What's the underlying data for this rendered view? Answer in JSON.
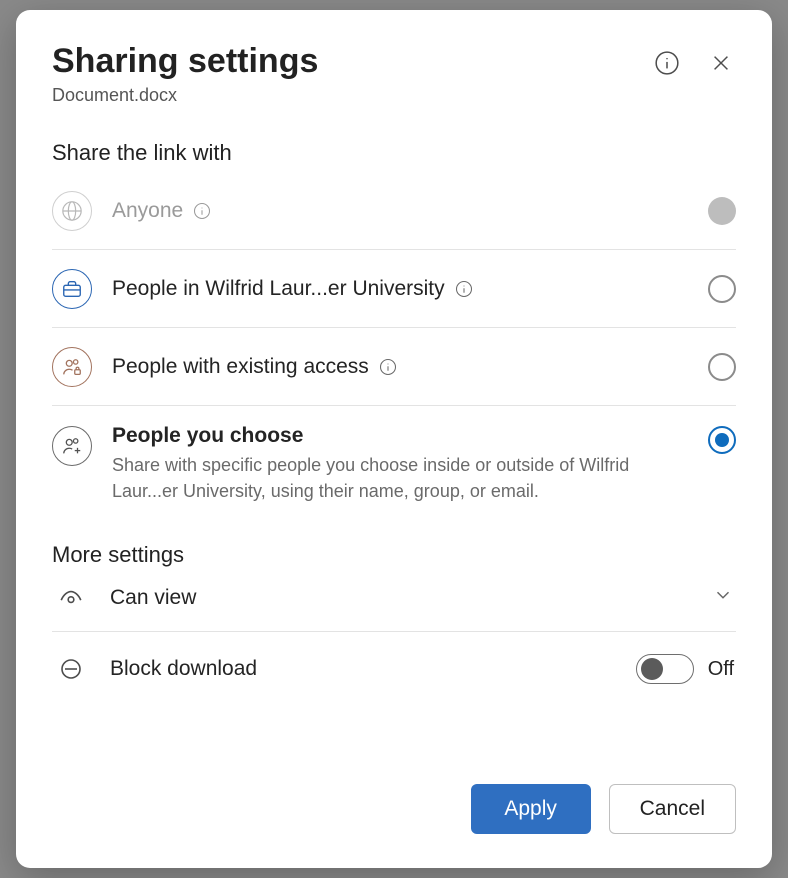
{
  "dialog": {
    "title": "Sharing settings",
    "file": "Document.docx"
  },
  "share_section": {
    "heading": "Share the link with",
    "options": [
      {
        "id": "anyone",
        "label": "Anyone",
        "description": "",
        "disabled": true,
        "selected": false,
        "has_info": true
      },
      {
        "id": "organization",
        "label": "People in Wilfrid Laur...er University",
        "description": "",
        "disabled": false,
        "selected": false,
        "has_info": true
      },
      {
        "id": "existing",
        "label": "People with existing access",
        "description": "",
        "disabled": false,
        "selected": false,
        "has_info": true
      },
      {
        "id": "specific",
        "label": "People you choose",
        "description": "Share with specific people you choose inside or outside of Wilfrid Laur...er University, using their name, group, or email.",
        "disabled": false,
        "selected": true,
        "has_info": false
      }
    ]
  },
  "more_settings": {
    "heading": "More settings",
    "permission": {
      "label": "Can view"
    },
    "block_download": {
      "label": "Block download",
      "on": false,
      "state_text": "Off"
    }
  },
  "footer": {
    "apply": "Apply",
    "cancel": "Cancel"
  }
}
